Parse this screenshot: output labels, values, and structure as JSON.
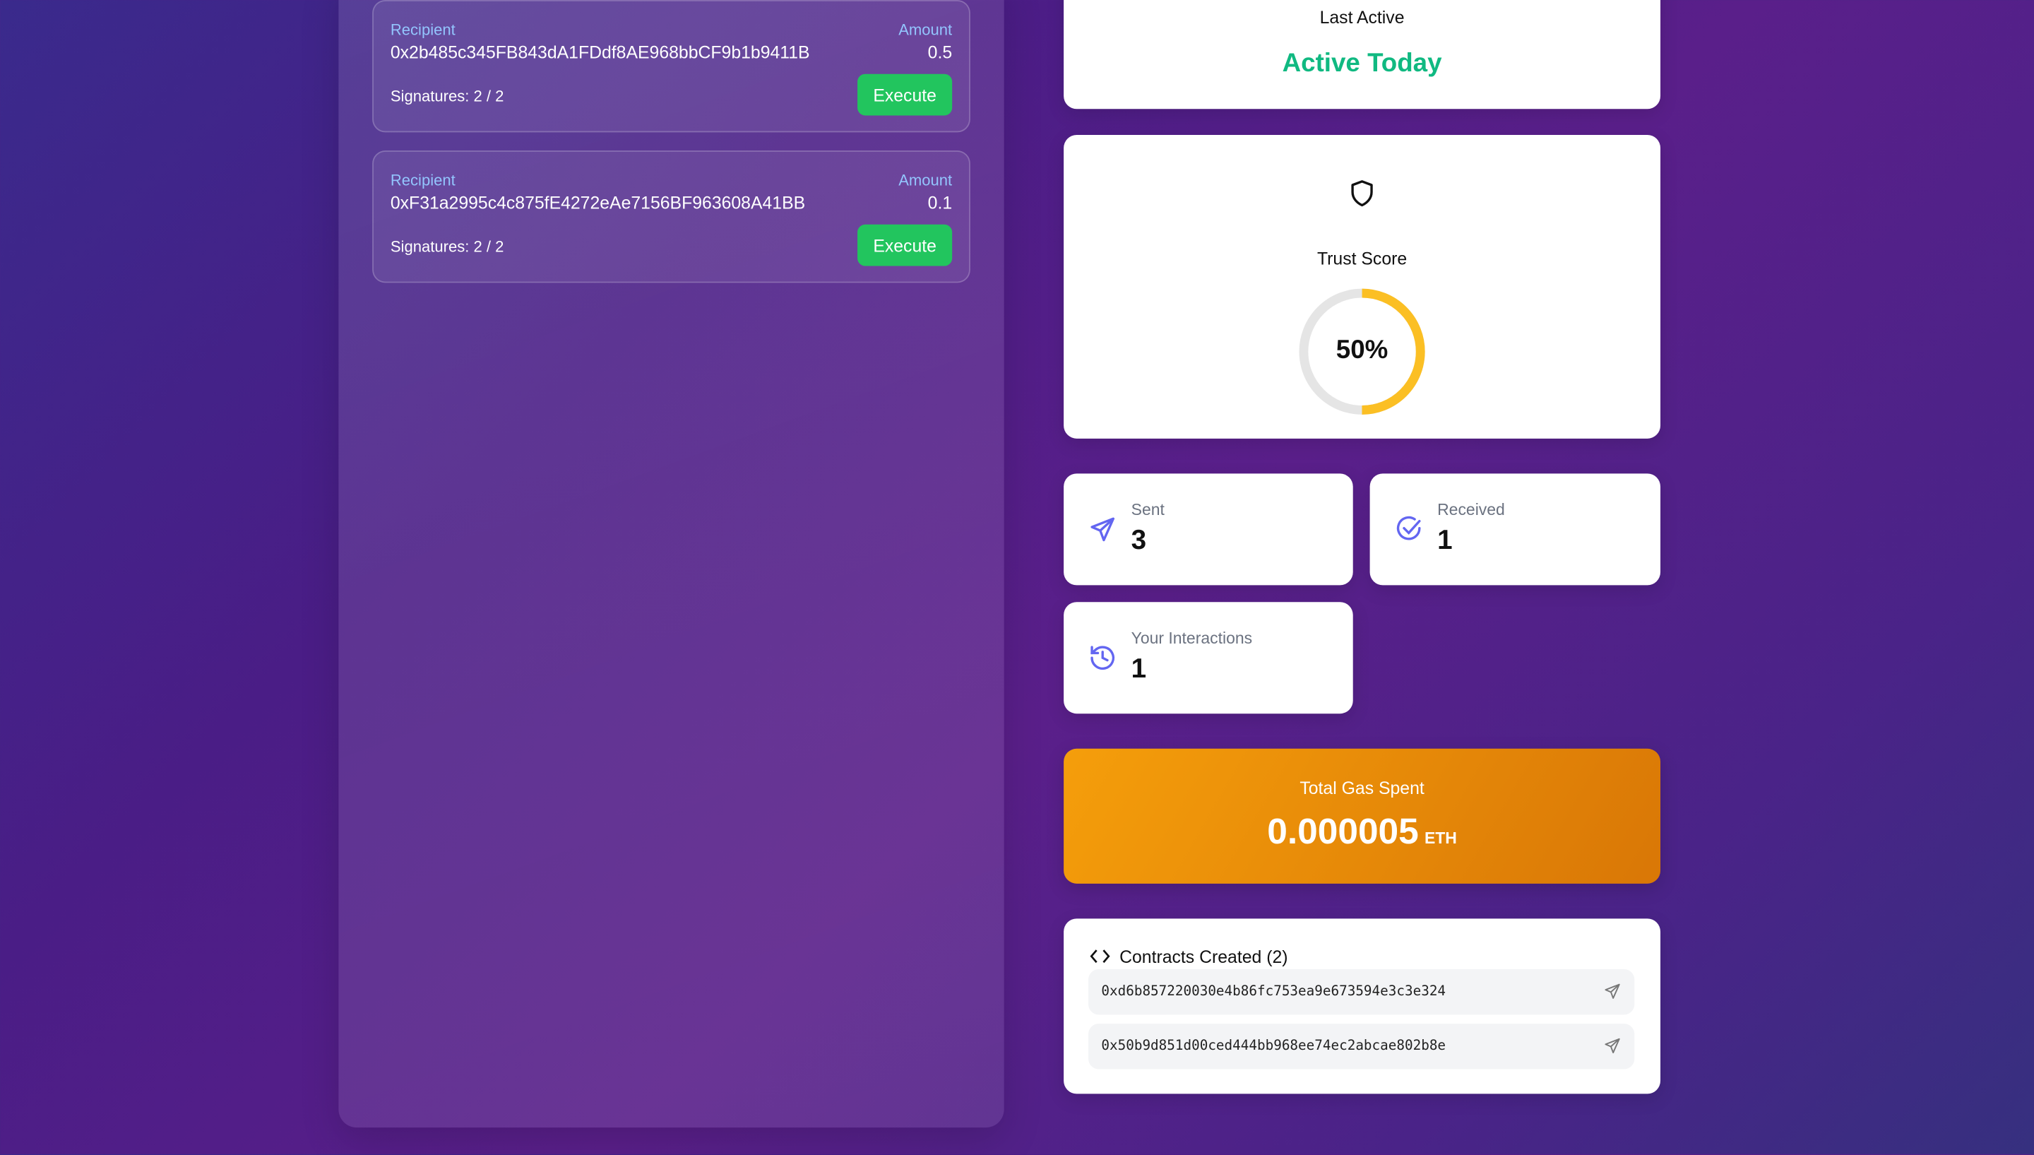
{
  "transactions": [
    {
      "recipient_label": "Recipient",
      "amount_label": "Amount",
      "recipient": "0x2b485c345FB843dA1FDdf8AE968bbCF9b1b9411B",
      "amount": "0.5",
      "signatures": "Signatures: 2 / 2",
      "action": "Execute"
    },
    {
      "recipient_label": "Recipient",
      "amount_label": "Amount",
      "recipient": "0xF31a2995c4c875fE4272eAe7156BF963608A41BB",
      "amount": "0.1",
      "signatures": "Signatures: 2 / 2",
      "action": "Execute"
    }
  ],
  "last_active": {
    "label": "Last Active",
    "value": "Active Today",
    "color": "#10b981"
  },
  "trust": {
    "icon": "shield-icon",
    "label": "Trust Score",
    "value_text": "50%",
    "percent": 50,
    "color": "#fbbf24"
  },
  "stats": [
    {
      "icon": "send-icon",
      "label": "Sent",
      "value": "3"
    },
    {
      "icon": "check-circle-icon",
      "label": "Received",
      "value": "1"
    },
    {
      "icon": "history-icon",
      "label": "Your Interactions",
      "value": "1"
    }
  ],
  "gas": {
    "label": "Total Gas Spent",
    "value": "0.000005",
    "unit": "ETH"
  },
  "contracts": {
    "icon": "code-icon",
    "title": "Contracts Created (2)",
    "items": [
      "0xd6b857220030e4b86fc753ea9e673594e3c3e324",
      "0x50b9d851d00ced444bb968ee74ec2abcae802b8e"
    ]
  },
  "colors": {
    "accent": "#6366f1",
    "success": "#22c55e",
    "gas": "#f59e0b"
  }
}
